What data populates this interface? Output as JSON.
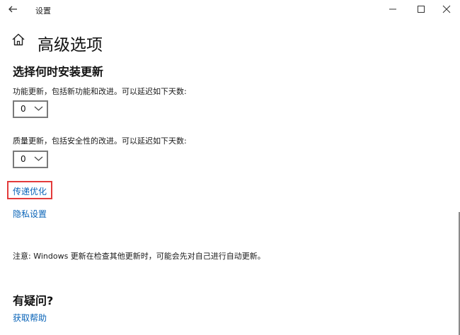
{
  "window": {
    "title": "设置",
    "back_icon": "arrow-left-icon",
    "minimize_icon": "minimize-icon",
    "maximize_icon": "maximize-icon",
    "close_icon": "close-icon"
  },
  "header": {
    "home_icon": "home-icon",
    "title": "高级选项"
  },
  "update_schedule": {
    "section_title": "选择何时安装更新",
    "feature_update": {
      "label": "功能更新，包括新功能和改进。可以延迟如下天数:",
      "value": "0"
    },
    "quality_update": {
      "label": "质量更新，包括安全性的改进。可以延迟如下天数:",
      "value": "0"
    }
  },
  "links": {
    "delivery_optimization": "传递优化",
    "privacy_settings": "隐私设置"
  },
  "note": "注意: Windows 更新在检查其他更新时，可能会先对自己进行自动更新。",
  "faq": {
    "title": "有疑问?",
    "get_help": "获取帮助"
  },
  "colors": {
    "link": "#0a64b8",
    "highlight_box": "#e33b3b",
    "select_border": "#7a7a7a"
  }
}
